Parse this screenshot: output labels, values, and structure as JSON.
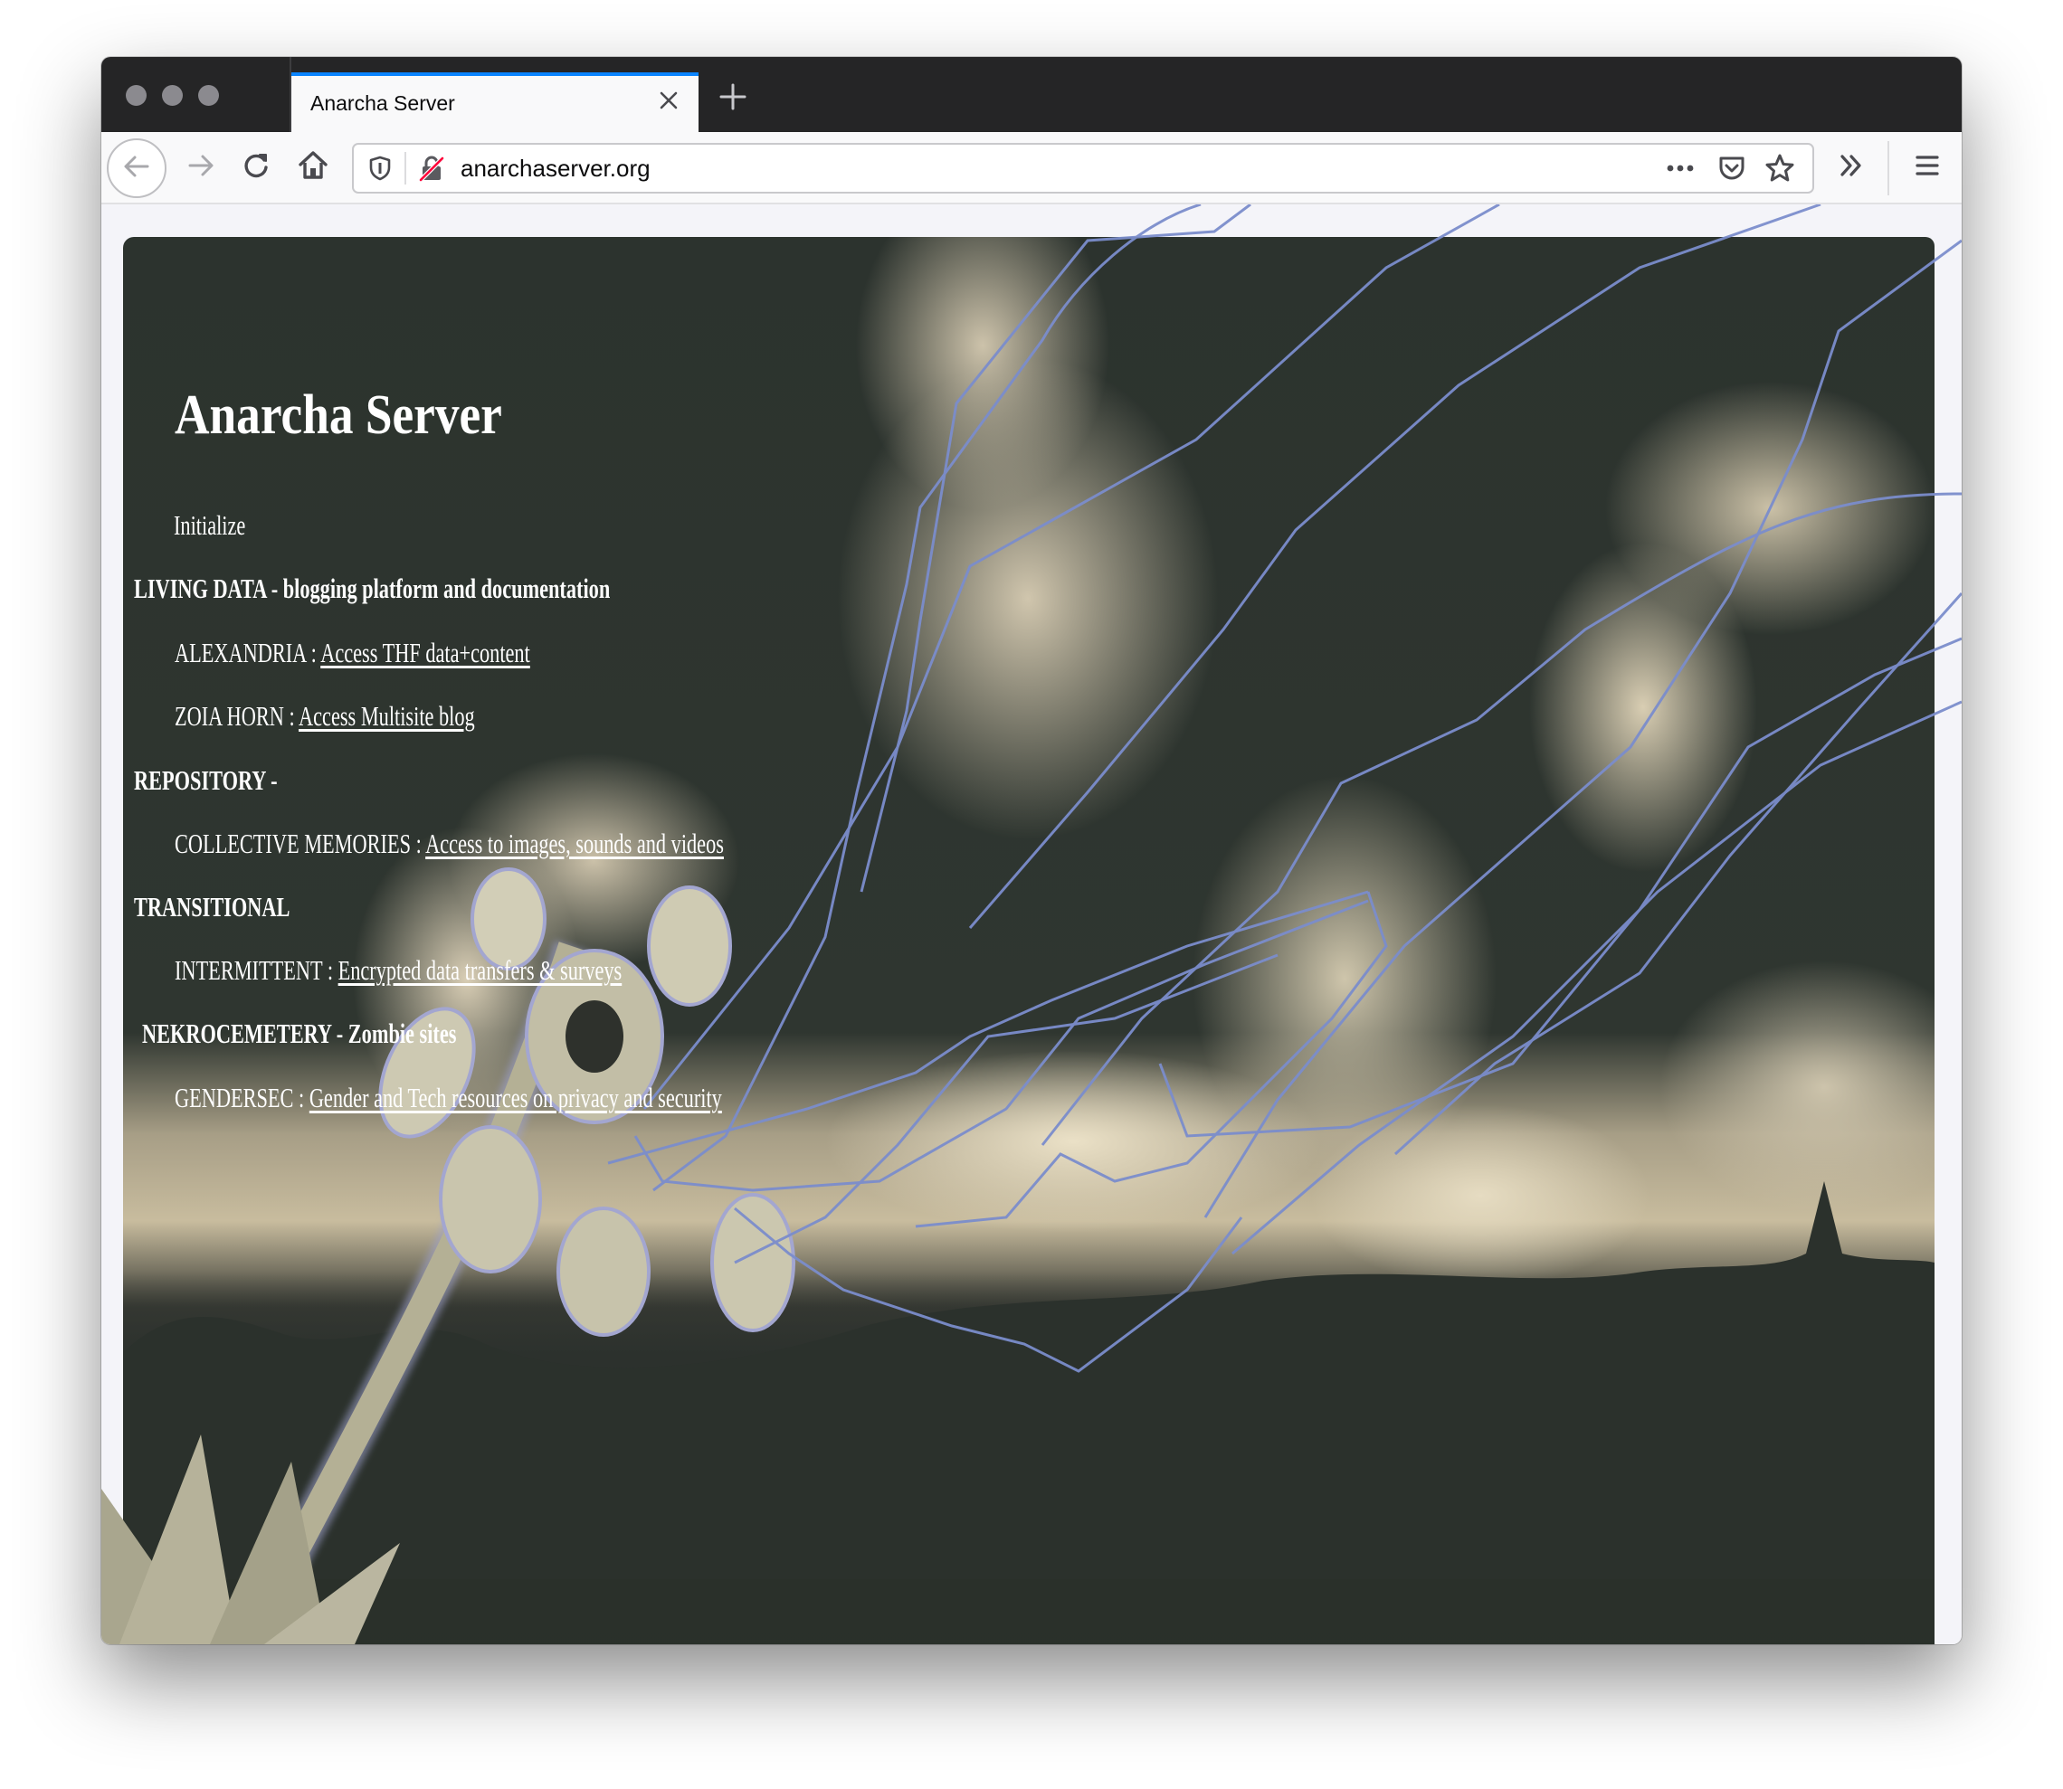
{
  "browser": {
    "tab": {
      "title": "Anarcha Server"
    },
    "toolbar": {
      "url": "anarchaserver.org",
      "icons": {
        "back": "arrow-left-icon",
        "forward": "arrow-right-icon",
        "reload": "reload-icon",
        "home": "home-icon",
        "tracking_protection": "shield-icon",
        "insecure": "lock-strikethrough-icon",
        "page_actions": "ellipsis-icon",
        "pocket": "pocket-icon",
        "bookmark": "star-icon",
        "overflow": "double-chevron-right-icon",
        "menu": "hamburger-menu-icon"
      }
    },
    "colors": {
      "tabstrip": "#252526",
      "active_tab_accent": "#0a84ff",
      "toolbar": "#f9f9fa",
      "insecure_slash": "#ff0039",
      "overlay_lines": "#7b8dcc"
    }
  },
  "page": {
    "title": "Anarcha Server",
    "intro": "Initialize",
    "sections": [
      {
        "heading": "LIVING DATA - blogging platform and documentation",
        "items": [
          {
            "label": "ALEXANDRIA : ",
            "link": "Access THF data+content"
          },
          {
            "label": "ZOIA HORN : ",
            "link": "Access Multisite blog"
          }
        ]
      },
      {
        "heading": "REPOSITORY -",
        "items": [
          {
            "label": "COLLECTIVE MEMORIES : ",
            "link": "Access to images, sounds and videos"
          }
        ]
      },
      {
        "heading": "TRANSITIONAL",
        "items": [
          {
            "label": "INTERMITTENT : ",
            "link": "Encrypted data transfers & surveys"
          }
        ]
      },
      {
        "heading": "NEKROCEMETERY - Zombie sites",
        "items": [
          {
            "label": "GENDERSEC : ",
            "link": "Gender and Tech resources on privacy and security"
          }
        ]
      }
    ],
    "background": "sepia-photo-explosion-with-flowers-and-blue-lines"
  }
}
